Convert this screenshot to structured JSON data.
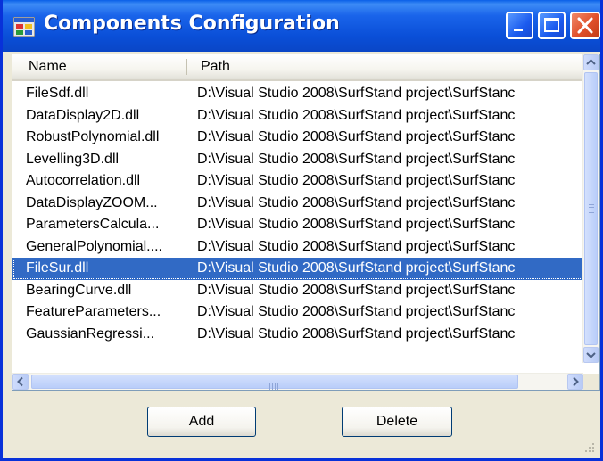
{
  "window": {
    "title": "Components Configuration",
    "icons": {
      "app": "app-icon",
      "minimize": "minimize-icon",
      "maximize": "maximize-icon",
      "close": "close-icon"
    }
  },
  "list": {
    "columns": [
      "Name",
      "Path"
    ],
    "rows": [
      {
        "name": "FileSdf.dll",
        "path": "D:\\Visual Studio 2008\\SurfStand project\\SurfStanc"
      },
      {
        "name": "DataDisplay2D.dll",
        "path": "D:\\Visual Studio 2008\\SurfStand project\\SurfStanc"
      },
      {
        "name": "RobustPolynomial.dll",
        "path": "D:\\Visual Studio 2008\\SurfStand project\\SurfStanc"
      },
      {
        "name": "Levelling3D.dll",
        "path": "D:\\Visual Studio 2008\\SurfStand project\\SurfStanc"
      },
      {
        "name": "Autocorrelation.dll",
        "path": "D:\\Visual Studio 2008\\SurfStand project\\SurfStanc"
      },
      {
        "name": "DataDisplayZOOM...",
        "path": "D:\\Visual Studio 2008\\SurfStand project\\SurfStanc"
      },
      {
        "name": "ParametersCalcula...",
        "path": "D:\\Visual Studio 2008\\SurfStand project\\SurfStanc"
      },
      {
        "name": "GeneralPolynomial....",
        "path": "D:\\Visual Studio 2008\\SurfStand project\\SurfStanc"
      },
      {
        "name": "FileSur.dll",
        "path": "D:\\Visual Studio 2008\\SurfStand project\\SurfStanc"
      },
      {
        "name": "BearingCurve.dll",
        "path": "D:\\Visual Studio 2008\\SurfStand project\\SurfStanc"
      },
      {
        "name": "FeatureParameters...",
        "path": "D:\\Visual Studio 2008\\SurfStand project\\SurfStanc"
      },
      {
        "name": "GaussianRegressi...",
        "path": "D:\\Visual Studio 2008\\SurfStand project\\SurfStanc"
      }
    ],
    "selected_index": 8
  },
  "buttons": {
    "add": "Add",
    "delete": "Delete"
  },
  "colors": {
    "titlebar": "#0a4fd8",
    "selection": "#316ac5",
    "window_bg": "#ece9d8"
  }
}
